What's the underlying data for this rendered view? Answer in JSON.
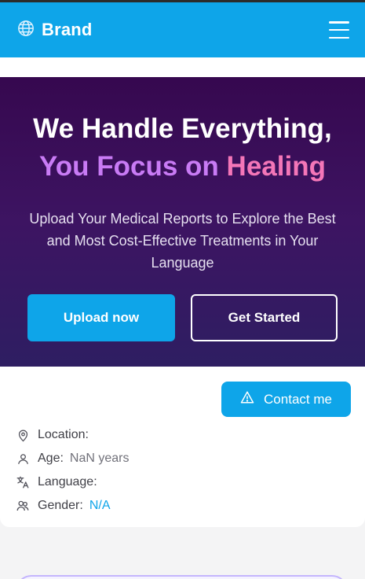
{
  "navbar": {
    "brand": "Brand",
    "globe_icon": "globe-icon",
    "menu_icon": "hamburger-menu-icon",
    "color": "#0ea5e9"
  },
  "hero": {
    "title_line1": "We Handle Everything,",
    "title_line2_part1": "You Focus on ",
    "title_line2_part2": "Healing",
    "subtitle": "Upload Your Medical Reports to Explore the Best and Most Cost-Effective Treatments in Your Language",
    "primary_button": "Upload now",
    "secondary_button": "Get Started"
  },
  "profile_card": {
    "contact_button": "Contact me",
    "contact_icon": "warning-triangle-icon",
    "items": [
      {
        "icon": "location-pin-icon",
        "label": "Location:",
        "value": ""
      },
      {
        "icon": "user-icon",
        "label": "Age:",
        "value": "NaN years"
      },
      {
        "icon": "translate-icon",
        "label": "Language:",
        "value": ""
      },
      {
        "icon": "users-icon",
        "label": "Gender:",
        "value": "N/A"
      }
    ]
  }
}
